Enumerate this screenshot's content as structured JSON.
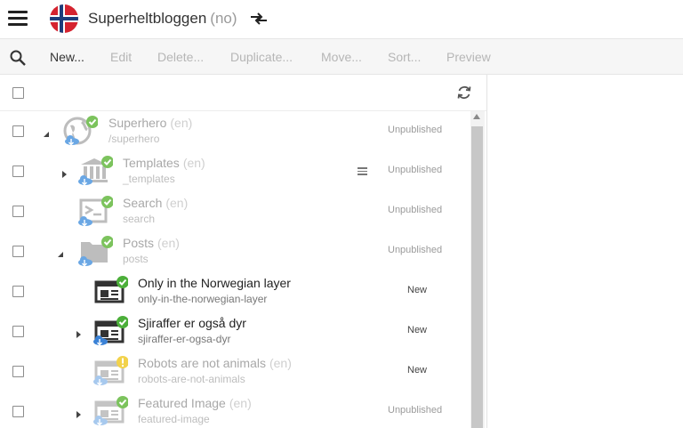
{
  "header": {
    "site_name": "Superheltbloggen",
    "site_lang": "(no)",
    "flag_icon": "norway-flag-icon",
    "switch_icon": "switch-arrows-icon"
  },
  "toolbar": {
    "search_icon": "search-icon",
    "buttons": [
      "New...",
      "Edit",
      "Delete...",
      "Duplicate...",
      "Move...",
      "Sort...",
      "Preview"
    ]
  },
  "list_header": {
    "refresh_icon": "refresh-icon"
  },
  "rows": [
    {
      "label": "Superhero",
      "lang": "(en)",
      "path": "/superhero",
      "status": "Unpublished",
      "icon": "globe-icon",
      "badge": "check",
      "toggle": "expanded"
    },
    {
      "label": "Templates",
      "lang": "(en)",
      "path": "_templates",
      "status": "Unpublished",
      "icon": "bank-icon",
      "badge": "check",
      "toggle": "collapsed"
    },
    {
      "label": "Search",
      "lang": "(en)",
      "path": "search",
      "status": "Unpublished",
      "icon": "search-page-icon",
      "badge": "check",
      "toggle": "none"
    },
    {
      "label": "Posts",
      "lang": "(en)",
      "path": "posts",
      "status": "Unpublished",
      "icon": "folder-icon",
      "badge": "check",
      "toggle": "expanded"
    },
    {
      "label": "Only in the Norwegian layer",
      "lang": "",
      "path": "only-in-the-norwegian-layer",
      "status": "New",
      "icon": "article-icon",
      "badge": "check",
      "toggle": "none"
    },
    {
      "label": "Sjiraffer er også dyr",
      "lang": "",
      "path": "sjiraffer-er-ogsa-dyr",
      "status": "New",
      "icon": "article-icon",
      "badge": "check",
      "toggle": "collapsed"
    },
    {
      "label": "Robots are not animals",
      "lang": "(en)",
      "path": "robots-are-not-animals",
      "status": "New",
      "icon": "article-icon",
      "badge": "warning",
      "toggle": "none"
    },
    {
      "label": "Featured Image",
      "lang": "(en)",
      "path": "featured-image",
      "status": "Unpublished",
      "icon": "article-icon",
      "badge": "check",
      "toggle": "collapsed"
    }
  ],
  "colors": {
    "check": "#7cc35d",
    "check_strong": "#4caf3a",
    "warning": "#f2d24b",
    "cloud": "#6aa7e4"
  }
}
